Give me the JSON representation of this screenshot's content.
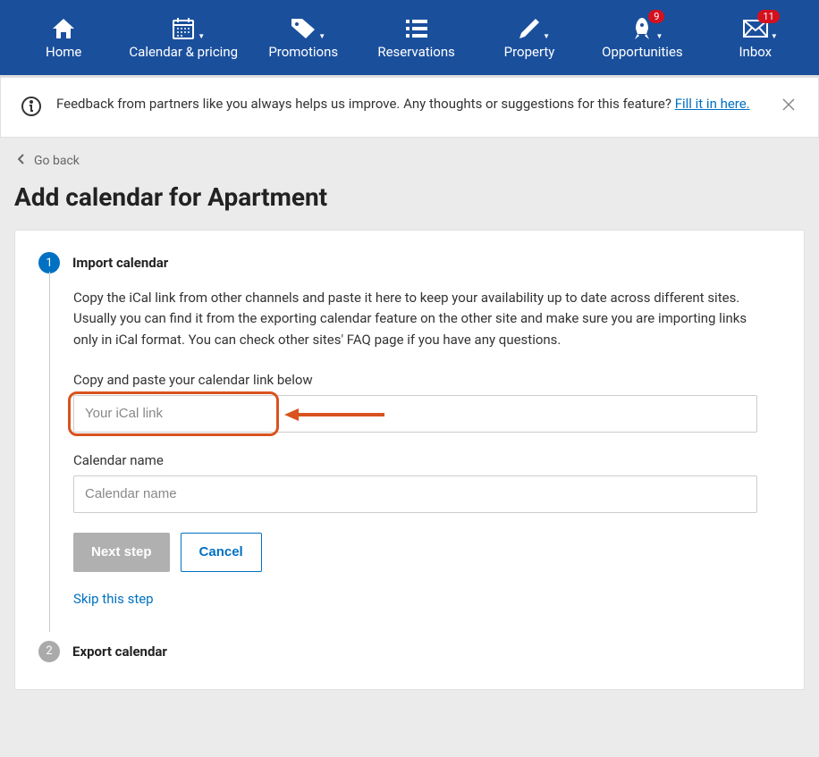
{
  "nav": {
    "items": [
      {
        "label": "Home",
        "icon": "home",
        "caret": false
      },
      {
        "label": "Calendar & pricing",
        "icon": "calendar",
        "caret": true
      },
      {
        "label": "Promotions",
        "icon": "tag",
        "caret": true
      },
      {
        "label": "Reservations",
        "icon": "list",
        "caret": false
      },
      {
        "label": "Property",
        "icon": "pencil",
        "caret": true
      },
      {
        "label": "Opportunities",
        "icon": "rocket",
        "caret": true,
        "badge": "9"
      },
      {
        "label": "Inbox",
        "icon": "mail",
        "caret": true,
        "badge": "11"
      }
    ]
  },
  "banner": {
    "text": "Feedback from partners like you always helps us improve. Any thoughts or suggestions for this feature? ",
    "link_text": "Fill it in here."
  },
  "back_label": "Go back",
  "page_title": "Add calendar for Apartment",
  "step1": {
    "number": "1",
    "title": "Import calendar",
    "desc": "Copy the iCal link from other channels and paste it here to keep your availability up to date across different sites. Usually you can find it from the exporting calendar feature on the other site and make sure you are importing links only in iCal format. You can check other sites' FAQ page if you have any questions.",
    "link_label": "Copy and paste your calendar link below",
    "link_placeholder": "Your iCal link",
    "name_label": "Calendar name",
    "name_placeholder": "Calendar name",
    "next_btn": "Next step",
    "cancel_btn": "Cancel",
    "skip_link": "Skip this step"
  },
  "step2": {
    "number": "2",
    "title": "Export calendar"
  }
}
